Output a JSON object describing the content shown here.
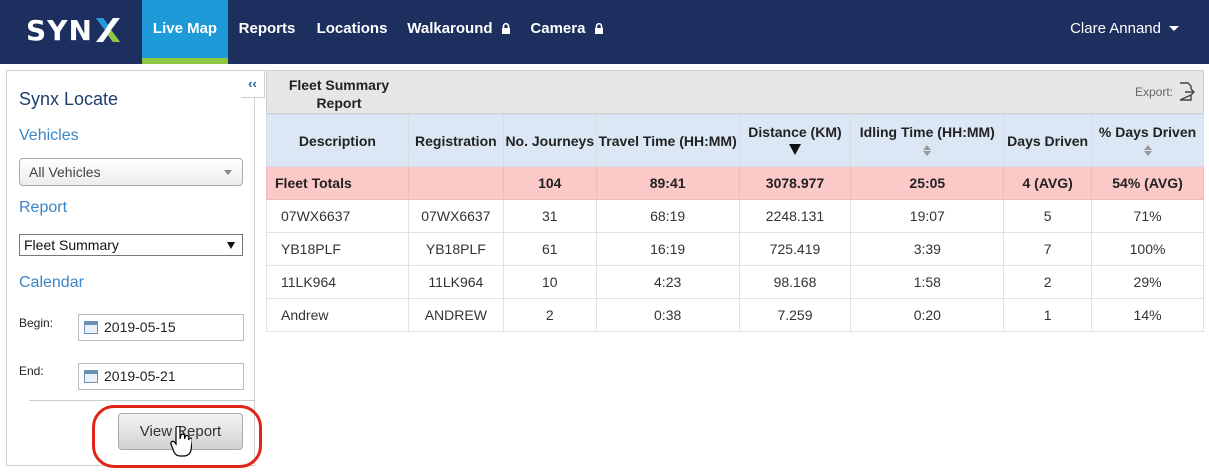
{
  "nav": {
    "logo": "SYN",
    "items": [
      {
        "label": "Live Map",
        "active": true,
        "locked": false
      },
      {
        "label": "Reports",
        "active": false,
        "locked": false
      },
      {
        "label": "Locations",
        "active": false,
        "locked": false
      },
      {
        "label": "Walkaround",
        "active": false,
        "locked": true
      },
      {
        "label": "Camera",
        "active": false,
        "locked": true
      }
    ],
    "user": "Clare Annand"
  },
  "sidebar": {
    "collapse_label": "‹‹",
    "title": "Synx Locate",
    "vehicles_heading": "Vehicles",
    "vehicles_value": "All Vehicles",
    "report_heading": "Report",
    "report_value": "Fleet Summary",
    "calendar_heading": "Calendar",
    "begin_label": "Begin:",
    "begin_value": "2019-05-15",
    "end_label": "End:",
    "end_value": "2019-05-21",
    "view_button": "View Report"
  },
  "report": {
    "title": "Fleet Summary Report",
    "export_label": "Export:",
    "columns": [
      {
        "label": "Description",
        "sort": "none"
      },
      {
        "label": "Registration",
        "sort": "none"
      },
      {
        "label": "No. Journeys",
        "sort": "none"
      },
      {
        "label": "Travel Time (HH:MM)",
        "sort": "none"
      },
      {
        "label": "Distance (KM)",
        "sort": "desc"
      },
      {
        "label": "Idling Time (HH:MM)",
        "sort": "both"
      },
      {
        "label": "Days Driven",
        "sort": "none"
      },
      {
        "label": "% Days Driven",
        "sort": "both"
      }
    ],
    "totals": [
      "Fleet Totals",
      "",
      "104",
      "89:41",
      "3078.977",
      "25:05",
      "4 (AVG)",
      "54% (AVG)"
    ],
    "rows": [
      [
        "07WX6637",
        "07WX6637",
        "31",
        "68:19",
        "2248.131",
        "19:07",
        "5",
        "71%"
      ],
      [
        "YB18PLF",
        "YB18PLF",
        "61",
        "16:19",
        "725.419",
        "3:39",
        "7",
        "100%"
      ],
      [
        "11LK964",
        "11LK964",
        "10",
        "4:23",
        "98.168",
        "1:58",
        "2",
        "29%"
      ],
      [
        "Andrew",
        "ANDREW",
        "2",
        "0:38",
        "7.259",
        "0:20",
        "1",
        "14%"
      ]
    ]
  },
  "colors": {
    "nav_bg": "#1c2f5e",
    "nav_active": "#1d9ad7",
    "nav_active_bar": "#8dc63f",
    "totals_bg": "#fcc9c9",
    "header_bg": "#dbe7f5",
    "highlight": "#e2231a"
  }
}
